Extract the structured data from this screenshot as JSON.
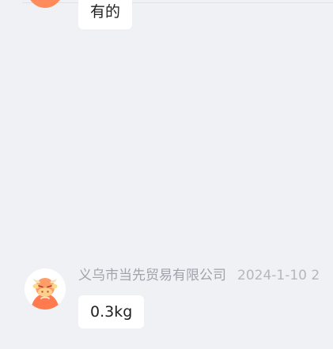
{
  "messages": [
    {
      "text": "有的"
    },
    {
      "sender": "义乌市当先贸易有限公司",
      "time": "2024-1-10 2",
      "text": "0.3kg"
    }
  ],
  "colors": {
    "background": "#f0f1f5",
    "bubble": "#ffffff",
    "sender_text": "#9fa3ab",
    "time_text": "#b4b7be",
    "avatar_accent": "#ff8a5b"
  },
  "icons": {
    "avatar": "bull-mascot-avatar-icon"
  }
}
